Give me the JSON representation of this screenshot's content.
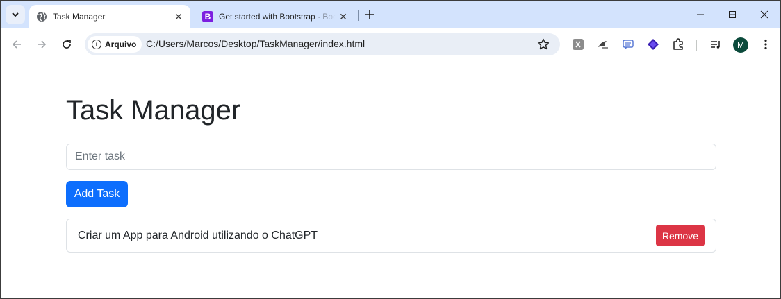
{
  "browser": {
    "tabs": [
      {
        "title": "Task Manager",
        "icon": "globe-icon",
        "active": true
      },
      {
        "title": "Get started with Bootstrap · Bootstrap",
        "icon": "bootstrap-icon",
        "favicon_letter": "B",
        "active": false
      }
    ],
    "omnibox": {
      "chip_label": "Arquivo",
      "url": "C:/Users/Marcos/Desktop/TaskManager/index.html"
    },
    "avatar_initial": "M",
    "colors": {
      "tabstrip": "#d3e3fd",
      "avatar": "#0b4a3b",
      "bootstrap_purple": "#7c1fe0"
    }
  },
  "page": {
    "title": "Task Manager",
    "input": {
      "placeholder": "Enter task",
      "value": ""
    },
    "add_button_label": "Add Task",
    "tasks": [
      {
        "text": "Criar um App para Android utilizando o ChatGPT",
        "remove_label": "Remove"
      }
    ],
    "colors": {
      "primary": "#0d6efd",
      "danger": "#dc3545",
      "text": "#212529"
    }
  }
}
